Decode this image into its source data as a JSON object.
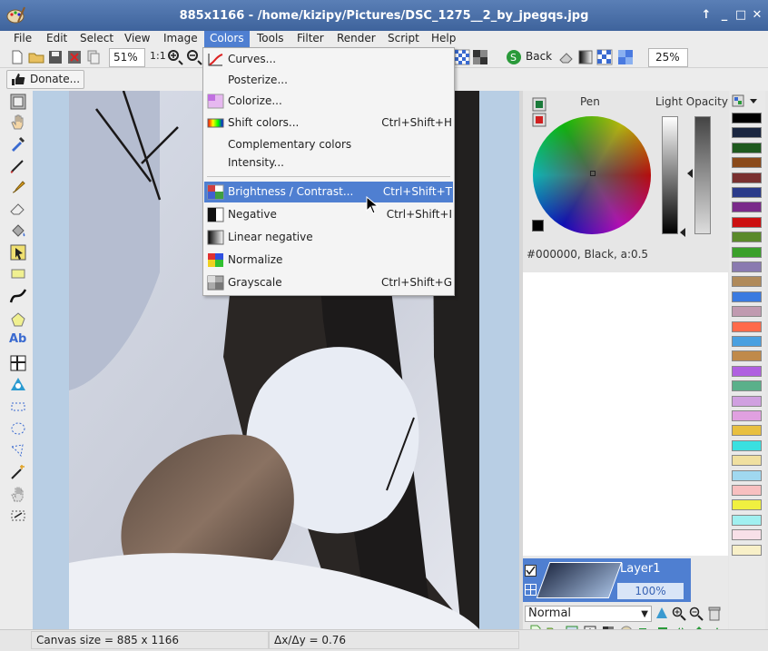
{
  "window": {
    "title": "885x1166 - /home/kizipy/Pictures/DSC_1275__2_by_jpegqs.jpg",
    "controls": [
      "↑",
      "_",
      "□",
      "✕"
    ]
  },
  "menubar": {
    "items": [
      "File",
      "Edit",
      "Select",
      "View",
      "Image",
      "Colors",
      "Tools",
      "Filter",
      "Render",
      "Script",
      "Help"
    ],
    "active": "Colors"
  },
  "toolbar": {
    "zoom_value": "51%",
    "zoom_1to1": "1:1",
    "back_label": "Back",
    "zoom2_value": "25%"
  },
  "donate": {
    "label": "Donate..."
  },
  "colors_menu": {
    "items": [
      {
        "label": "Curves...",
        "accel": "",
        "icon": "curves-icon"
      },
      {
        "label": "Posterize...",
        "accel": "",
        "icon": ""
      },
      {
        "label": "Colorize...",
        "accel": "",
        "icon": "colorize-icon"
      },
      {
        "label": "Shift colors...",
        "accel": "Ctrl+Shift+H",
        "icon": "shift-colors-icon"
      },
      {
        "label": "Complementary colors",
        "accel": "",
        "icon": ""
      },
      {
        "label": "Intensity...",
        "accel": "",
        "icon": ""
      },
      {
        "label": "Brightness / Contrast...",
        "accel": "Ctrl+Shift+T",
        "icon": "brightness-contrast-icon",
        "highlighted": true
      },
      {
        "label": "Negative",
        "accel": "Ctrl+Shift+I",
        "icon": "negative-icon"
      },
      {
        "label": "Linear negative",
        "accel": "",
        "icon": "linear-negative-icon"
      },
      {
        "label": "Normalize",
        "accel": "",
        "icon": "normalize-icon"
      },
      {
        "label": "Grayscale",
        "accel": "Ctrl+Shift+G",
        "icon": "grayscale-icon"
      }
    ]
  },
  "color_panel": {
    "pen_label": "Pen",
    "light_opacity_label": "Light Opacity",
    "color_info": "#000000, Black, a:0.5",
    "pen_color": "#000000"
  },
  "layers": {
    "layer_name": "Layer1",
    "layer_opacity": "100%",
    "blend_mode": "Normal"
  },
  "palette": {
    "colors": [
      "#000000",
      "#1a2640",
      "#1e5a1e",
      "#8a4a1a",
      "#7a3030",
      "#2a3a8a",
      "#7a2a8a",
      "#cc1010",
      "#5a8a2a",
      "#3aa02a",
      "#8a7ab0",
      "#b08a5a",
      "#3a7ae0",
      "#c09ab0",
      "#ff6a4a",
      "#4aa0e0",
      "#c08a4a",
      "#b060e0",
      "#5ab08a",
      "#d0a0e0",
      "#e0a0e0",
      "#e8c040",
      "#3ae0e0",
      "#f0e0a0",
      "#a0d8f0",
      "#f8c0c0",
      "#f0f040",
      "#a0f0f0",
      "#f8e0e8",
      "#f8f0c8"
    ]
  },
  "status": {
    "canvas_size": "Canvas size = 885 x 1166",
    "dxdy": "Δx/Δy = 0.76"
  }
}
